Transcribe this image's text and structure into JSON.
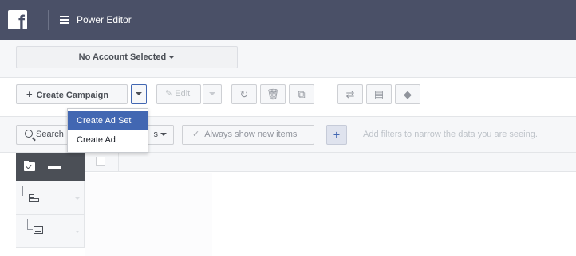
{
  "topbar": {
    "logo_letter": "f",
    "title": "Power Editor"
  },
  "account": {
    "label": "No Account Selected"
  },
  "toolbar": {
    "create_campaign_label": "Create Campaign",
    "edit_label": "Edit"
  },
  "create_menu": {
    "items": [
      "Create Ad Set",
      "Create Ad"
    ]
  },
  "filter_bar": {
    "search_label": "Search",
    "filters_label": "s",
    "always_show_label": "Always show new items",
    "add_filter_label": "+",
    "hint": "Add filters to narrow the data you are seeing."
  },
  "colors": {
    "topbar": "#4a5067",
    "accent": "#4267b2"
  },
  "icons": [
    "facebook-logo",
    "menu-icon",
    "caret-down-icon",
    "pencil-icon",
    "undo-icon",
    "trash-icon",
    "duplicate-icon",
    "export-icon",
    "note-icon",
    "tag-icon",
    "search-icon",
    "check-icon",
    "folder-check-icon",
    "minus-icon",
    "ad-set-icon",
    "ad-icon"
  ]
}
